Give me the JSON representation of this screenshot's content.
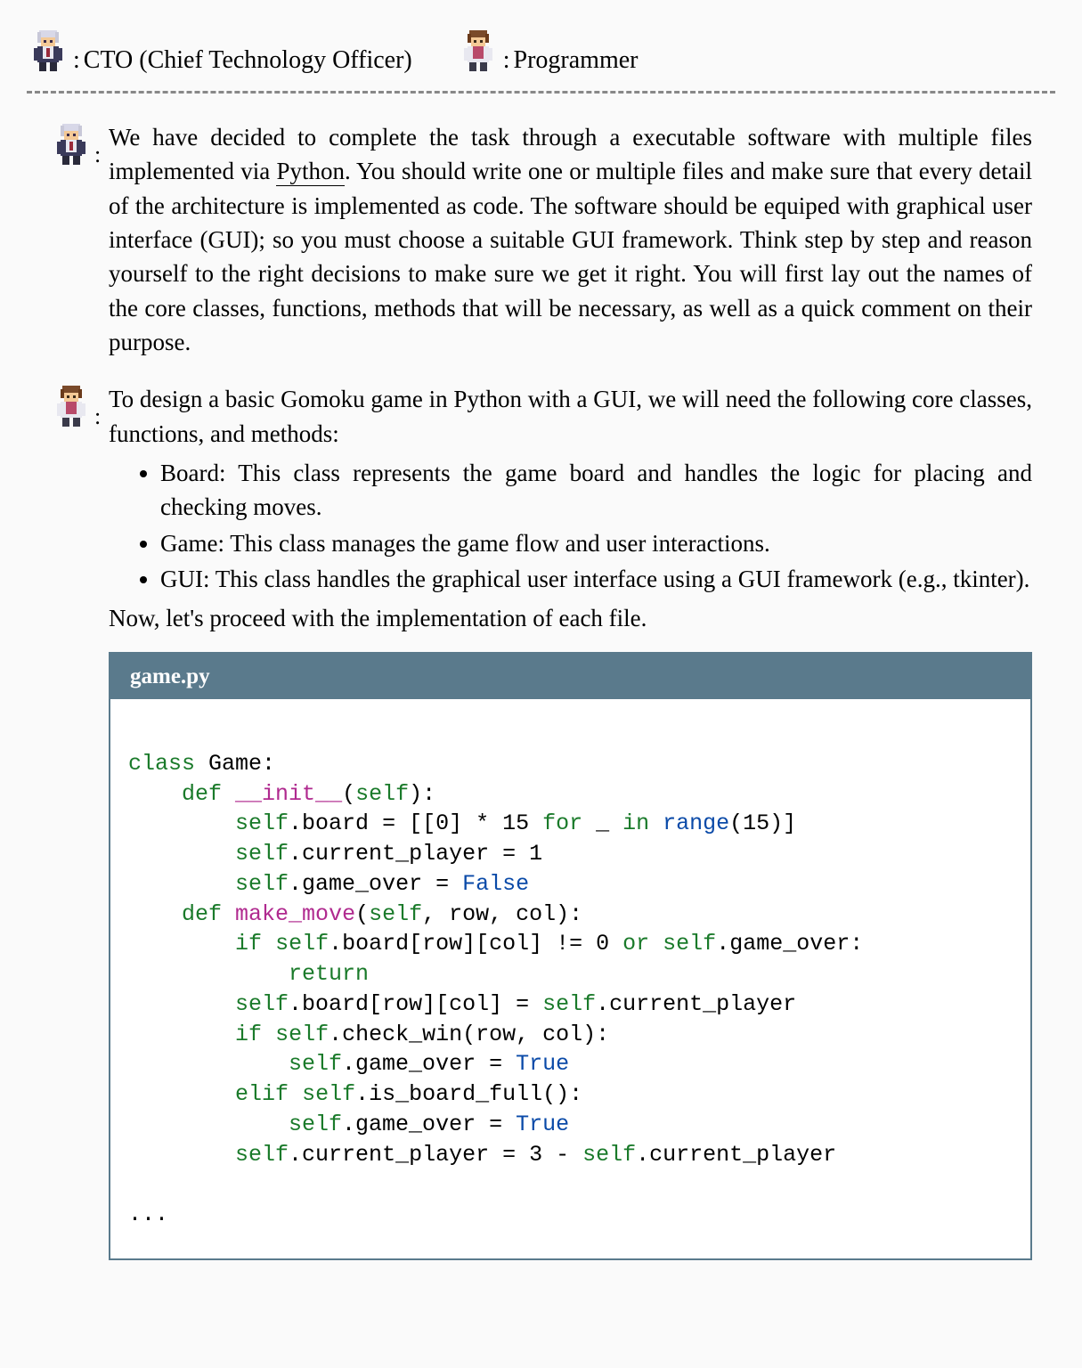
{
  "legend": {
    "cto": {
      "icon_label": "cto-avatar",
      "role": "CTO (Chief Technology Officer)"
    },
    "programmer": {
      "icon_label": "programmer-avatar",
      "role": "Programmer"
    }
  },
  "dialog": {
    "cto_message": "We have decided to complete the task through a executable software with multiple files implemented via Python. You should write one or multiple files and make sure that every detail of the architecture is implemented as code. The software should be equiped with graphical user interface (GUI); so you must choose a suitable GUI framework. Think step by step and reason yourself to the right decisions to make sure we get it right. You will first lay out the names of the core classes, functions, methods that will be necessary, as well as a quick comment on their purpose.",
    "programmer_intro": "To design a basic Gomoku game in Python with a GUI, we will need the following core classes, functions, and methods:",
    "bullets": [
      "Board: This class represents the game board and handles the logic for placing and checking moves.",
      "Game: This class manages the game flow and user interactions.",
      "GUI: This class handles the graphical user interface using a GUI framework (e.g., tkinter)."
    ],
    "programmer_outro": "Now, let's proceed with the implementation of each file.",
    "code_filename": "game.py",
    "code_ellipsis": "..."
  },
  "python_underline_word": "Python"
}
